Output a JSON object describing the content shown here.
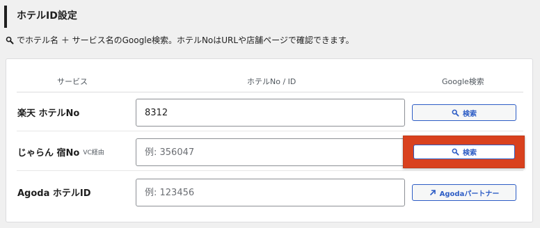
{
  "section": {
    "title": "ホテルID設定"
  },
  "help": {
    "icon": "search-icon",
    "text": "でホテル名 ＋ サービス名のGoogle検索。ホテルNoはURLや店舗ページで確認できます。"
  },
  "table": {
    "headers": {
      "service": "サービス",
      "id": "ホテルNo / ID",
      "google": "Google検索"
    },
    "rows": [
      {
        "label": "楽天 ホテルNo",
        "sublabel": "",
        "value": "8312",
        "placeholder": "",
        "button_label": "検索",
        "button_icon": "search-icon"
      },
      {
        "label": "じゃらん 宿No",
        "sublabel": "VC経由",
        "value": "",
        "placeholder": "例: 356047",
        "button_label": "検索",
        "button_icon": "search-icon",
        "highlighted": true
      },
      {
        "label": "Agoda ホテルID",
        "sublabel": "",
        "value": "",
        "placeholder": "例: 123456",
        "button_label": "Agodaパートナー",
        "button_icon": "external-link-icon"
      }
    ]
  },
  "colors": {
    "accent": "#2c5cc5",
    "highlight": "#d9411e",
    "title_border": "#1e1e1e"
  }
}
